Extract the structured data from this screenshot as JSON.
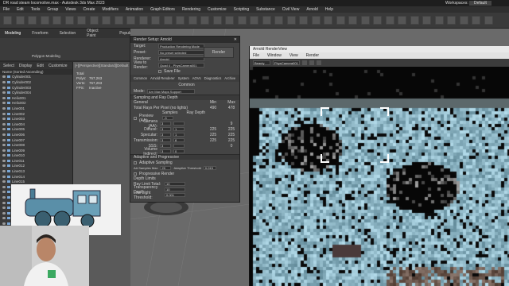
{
  "window": {
    "title": "DR road steam locomotive.max - Autodesk 3ds Max 2023",
    "workspace_label": "Workspaces:",
    "workspace_value": "Default"
  },
  "menu": [
    "File",
    "Edit",
    "Tools",
    "Group",
    "Views",
    "Create",
    "Modifiers",
    "Animation",
    "Graph Editors",
    "Rendering",
    "Customize",
    "Scripting",
    "Substance",
    "Civil View",
    "Arnold",
    "Help"
  ],
  "ribbon": {
    "tabs": [
      "Modeling",
      "Freeform",
      "Selection",
      "Object Paint",
      "Populate"
    ],
    "panel_label": "Polygon Modeling"
  },
  "explorer": {
    "tabs": [
      "Select",
      "Display",
      "Edit",
      "Customize"
    ],
    "header": "Name (Sorted Ascending)",
    "items": [
      "Cylinder001",
      "Cylinder002",
      "Cylinder003",
      "Cylinder004",
      "Helix001",
      "Helix002",
      "Line001",
      "Line002",
      "Line003",
      "Line004",
      "Line005",
      "Line006",
      "Line007",
      "Line008",
      "Line009",
      "Line010",
      "Line011",
      "Line012",
      "Line013",
      "Line014",
      "Line015",
      "Line016",
      "Line017",
      "Line018",
      "Line019",
      "Line020",
      "Line021",
      "Line022",
      "Line023",
      "Object013"
    ]
  },
  "viewport": {
    "label": "[+][Perspective][Standard][Default Shading]",
    "stats": [
      {
        "k": "Total",
        "v": ""
      },
      {
        "k": "Polys:",
        "v": "767,263"
      },
      {
        "k": "Verts:",
        "v": "767,263"
      },
      {
        "k": "FPS:",
        "v": "Inactive"
      }
    ]
  },
  "render_setup": {
    "title": "Render Setup: Arnold",
    "fields": [
      {
        "label": "Target:",
        "value": "Production Rendering Mode"
      },
      {
        "label": "Preset:",
        "value": "No preset selected"
      },
      {
        "label": "Renderer:",
        "value": "Arnold"
      },
      {
        "label": "View to Render:",
        "value": "Quad 4 - PhysCamera001"
      }
    ],
    "save_file": "Save File",
    "render_button": "Render",
    "tabs_row1": [
      "Common",
      "Arnold Renderer",
      "System",
      "AOVs",
      "Diagnostics",
      "Archive"
    ],
    "tab_header": "Common",
    "mode_label": "Mode:",
    "mode_value": "Arn Max Maps Support",
    "section": "Sampling and Ray Depth",
    "general": "General",
    "min_label": "Min",
    "max_label": "Max",
    "total_label": "Total Rays Per Pixel (no lights)",
    "total_min": "490",
    "total_max": "478",
    "col_samples": "Samples",
    "col_raydepth": "Ray Depth",
    "preview_label": "Preview (AA):",
    "preview_value": "-3",
    "rows": [
      {
        "label": "Camera (AA):",
        "samples": "3",
        "depth": "",
        "min": "",
        "max": "9"
      },
      {
        "label": "Diffuse:",
        "samples": "3",
        "depth": "1",
        "min": "225",
        "max": "225"
      },
      {
        "label": "Specular:",
        "samples": "3",
        "depth": "1",
        "min": "225",
        "max": "225"
      },
      {
        "label": "Transmission:",
        "samples": "3",
        "depth": "8",
        "min": "225",
        "max": "225"
      },
      {
        "label": "SSS:",
        "samples": "3",
        "depth": "",
        "min": "",
        "max": "0"
      },
      {
        "label": "Volume Indirect:",
        "samples": "3",
        "depth": "0",
        "min": "",
        "max": ""
      }
    ],
    "adaptive_section": "Adaptive and Progressive",
    "adaptive_sampling": "Adaptive Sampling",
    "aa_samples_max_label": "AA Samples Max",
    "aa_samples_max": "20",
    "adaptive_threshold_label": "Adaptive Threshold",
    "adaptive_threshold": "0.015",
    "progressive": "Progressive Render",
    "depth_limits": "Depth Limits",
    "ray_limit_label": "Ray Limit Total:",
    "ray_limit": "10",
    "transparency_label": "Transparency Depth:",
    "transparency": "10",
    "low_light_label": "Low Light Threshold:",
    "low_light": "0.001"
  },
  "renderview": {
    "title": "Arnold RenderView",
    "menu": [
      "File",
      "Window",
      "View",
      "Render"
    ],
    "toolbar_value": "Beauty",
    "camera_value": "PhysCamera001"
  },
  "colors": {
    "accent": "#4e6a8f",
    "region": "#ffffff"
  }
}
